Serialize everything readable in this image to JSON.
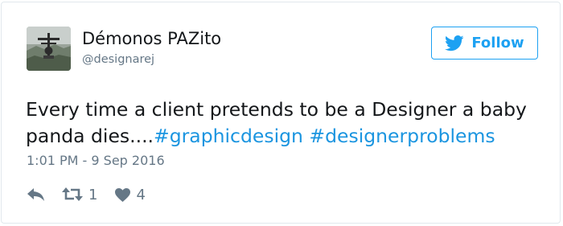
{
  "tweet": {
    "author": {
      "display_name": "Démonos PAZito",
      "handle": "@designarej"
    },
    "follow_label": "Follow",
    "text_parts": {
      "line1": "Every time a client pretends to be a Designer a baby",
      "line2_plain": "panda dies....",
      "hashtag1": "#graphicdesign",
      "hashtag2": "#designerproblems"
    },
    "timestamp": "1:01 PM - 9 Sep 2016",
    "actions": {
      "reply_icon": "reply-icon",
      "retweet_icon": "retweet-icon",
      "retweet_count": "1",
      "like_icon": "heart-icon",
      "like_count": "4"
    }
  },
  "colors": {
    "accent": "#1da1f2",
    "hashtag": "#1b95e0",
    "muted": "#657786",
    "text": "#14171a",
    "border": "#e1e8ed"
  }
}
